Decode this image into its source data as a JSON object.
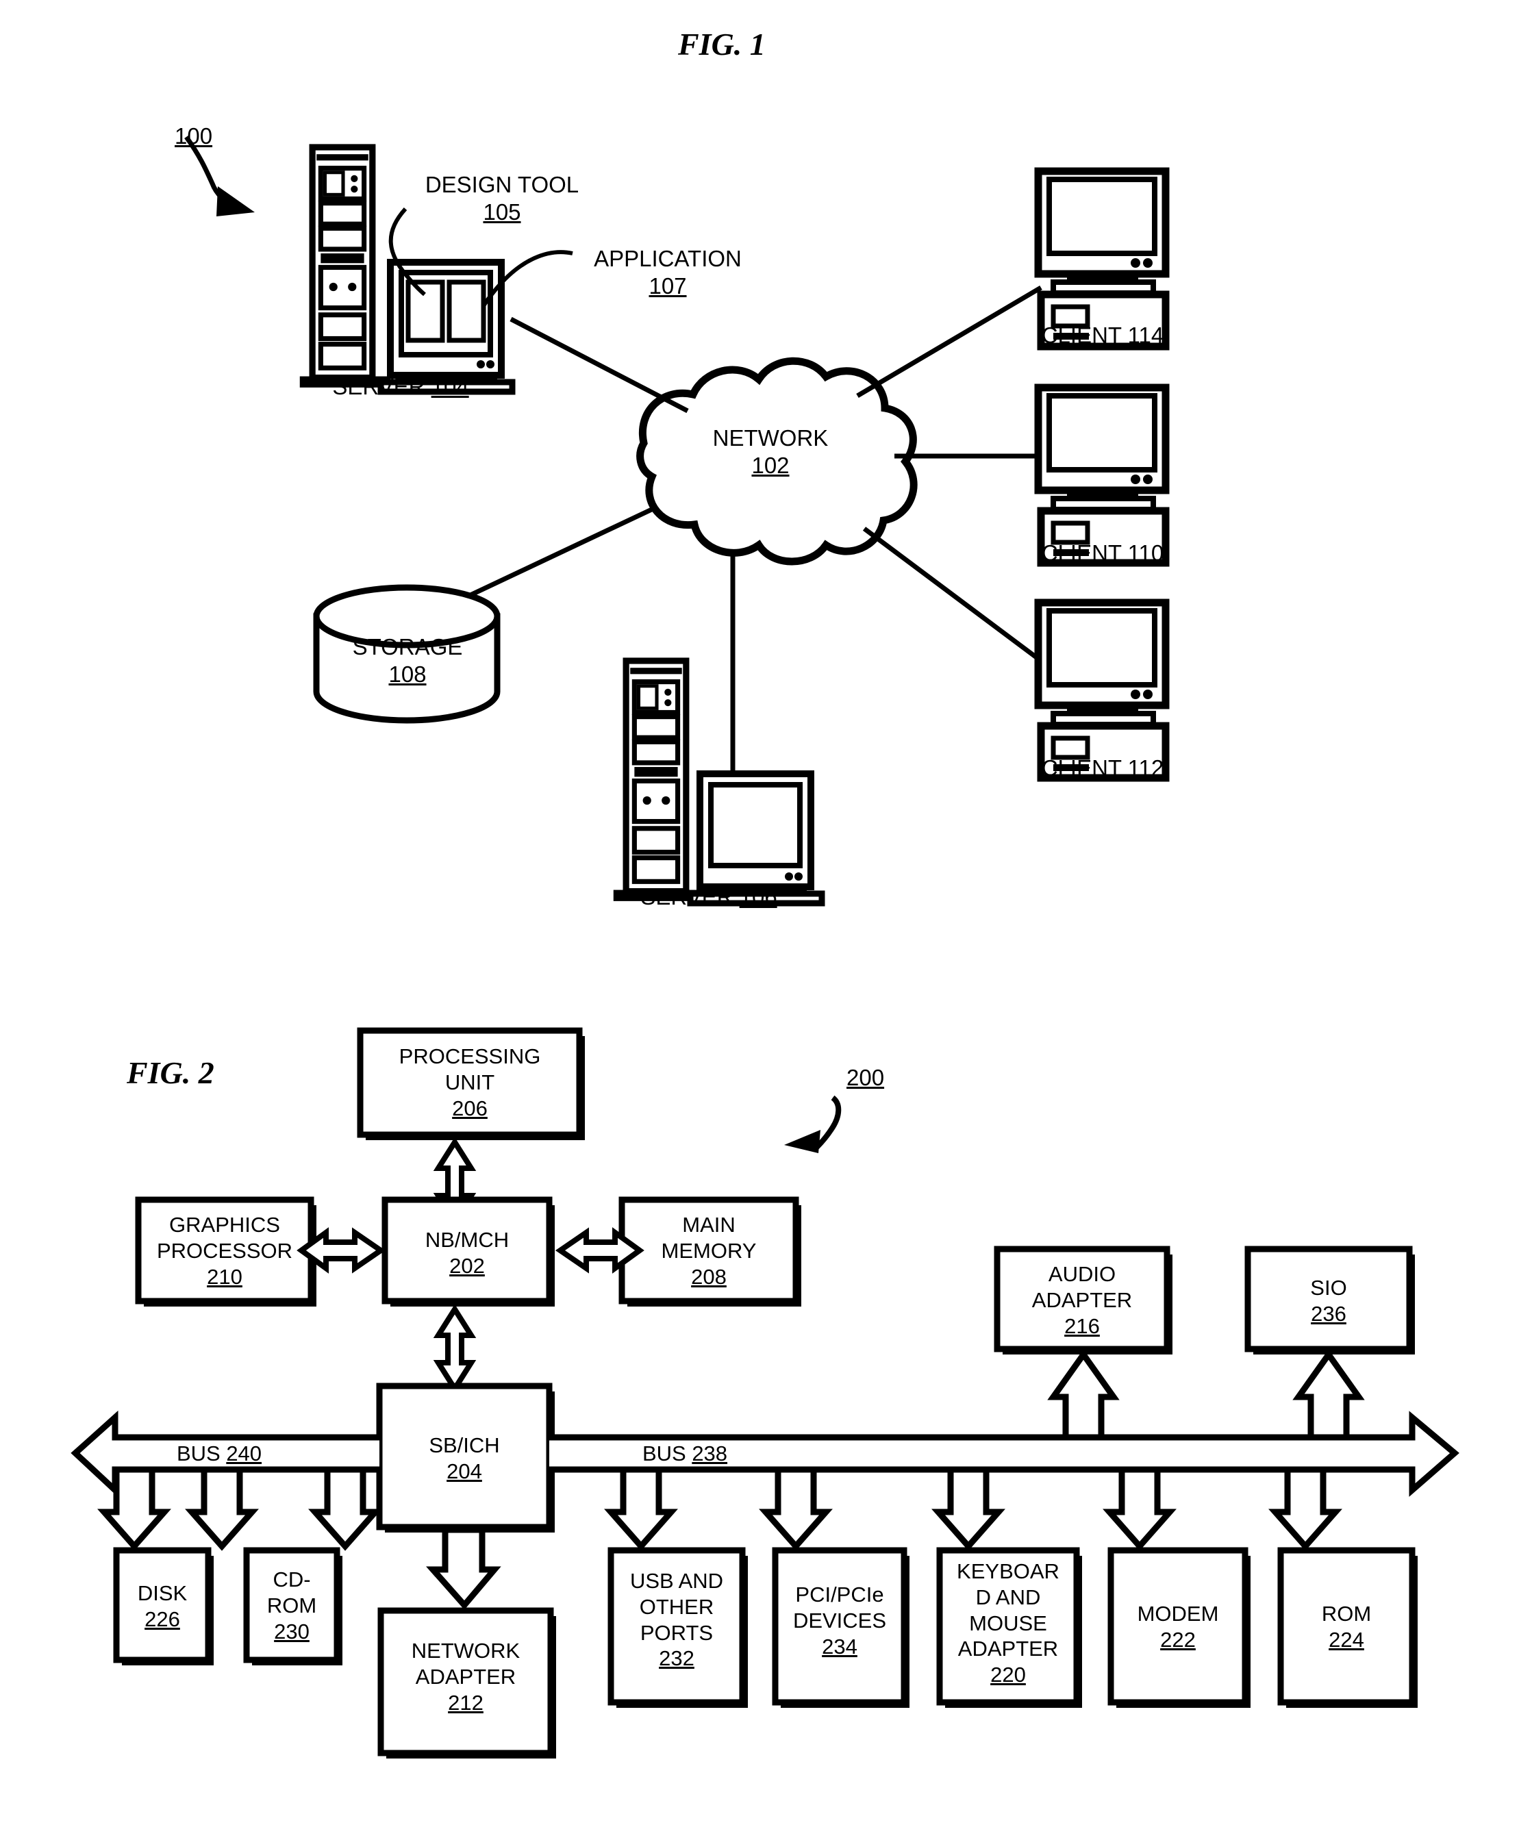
{
  "figures": [
    {
      "id": "fig1",
      "title": "FIG. 1",
      "ref": "100",
      "caption_nodes": [
        {
          "name": "server-104",
          "label": "SERVER ",
          "number": "104"
        },
        {
          "name": "design-tool-105",
          "label": "DESIGN TOOL",
          "number": "105"
        },
        {
          "name": "application-107",
          "label": "APPLICATION",
          "number": "107"
        },
        {
          "name": "network-102",
          "label": "NETWORK",
          "number": "102"
        },
        {
          "name": "storage-108",
          "label": "STORAGE",
          "number": "108"
        },
        {
          "name": "server-106",
          "label": "SERVER ",
          "number": "106"
        },
        {
          "name": "client-114",
          "label": "CLIENT ",
          "number": "114"
        },
        {
          "name": "client-110",
          "label": "CLIENT ",
          "number": "110"
        },
        {
          "name": "client-112",
          "label": "CLIENT ",
          "number": "112"
        }
      ]
    },
    {
      "id": "fig2",
      "title": "FIG. 2",
      "ref": "200",
      "boxes": [
        {
          "name": "processing-unit",
          "lines": [
            "PROCESSING",
            "UNIT"
          ],
          "number": "206"
        },
        {
          "name": "graphics-processor",
          "lines": [
            "GRAPHICS",
            "PROCESSOR"
          ],
          "number": "210"
        },
        {
          "name": "nb-mch",
          "lines": [
            "NB/MCH"
          ],
          "number": "202"
        },
        {
          "name": "main-memory",
          "lines": [
            "MAIN",
            "MEMORY"
          ],
          "number": "208"
        },
        {
          "name": "audio-adapter",
          "lines": [
            "AUDIO",
            "ADAPTER"
          ],
          "number": "216"
        },
        {
          "name": "sio",
          "lines": [
            "SIO"
          ],
          "number": "236"
        },
        {
          "name": "sb-ich",
          "lines": [
            "SB/ICH"
          ],
          "number": "204"
        },
        {
          "name": "disk",
          "lines": [
            "DISK"
          ],
          "number": "226"
        },
        {
          "name": "cd-rom",
          "lines": [
            "CD-",
            "ROM"
          ],
          "number": "230"
        },
        {
          "name": "network-adapter",
          "lines": [
            "NETWORK",
            "ADAPTER"
          ],
          "number": "212"
        },
        {
          "name": "usb-and-other-ports",
          "lines": [
            "USB AND",
            "OTHER",
            "PORTS"
          ],
          "number": "232"
        },
        {
          "name": "pci-pcie-devices",
          "lines": [
            "PCI/PCIe",
            "DEVICES"
          ],
          "number": "234"
        },
        {
          "name": "keyboard-and-mouse-adapter",
          "lines": [
            "KEYBOAR",
            "D AND",
            "MOUSE",
            "ADAPTER"
          ],
          "number": "220"
        },
        {
          "name": "modem",
          "lines": [
            "MODEM"
          ],
          "number": "222"
        },
        {
          "name": "rom",
          "lines": [
            "ROM"
          ],
          "number": "224"
        }
      ],
      "buses": [
        {
          "name": "bus-240",
          "label": "BUS ",
          "number": "240"
        },
        {
          "name": "bus-238",
          "label": "BUS ",
          "number": "238"
        }
      ]
    }
  ],
  "fig1": {
    "title": "FIG. 1",
    "ref": "100",
    "server104": {
      "label": "SERVER ",
      "number": "104"
    },
    "design_tool": {
      "label": "DESIGN TOOL",
      "number": "105"
    },
    "application": {
      "label": "APPLICATION",
      "number": "107"
    },
    "network": {
      "label": "NETWORK",
      "number": "102"
    },
    "storage": {
      "label": "STORAGE",
      "number": "108"
    },
    "server106": {
      "label": "SERVER ",
      "number": "106"
    },
    "client114": {
      "label": "CLIENT ",
      "number": "114"
    },
    "client110": {
      "label": "CLIENT ",
      "number": "110"
    },
    "client112": {
      "label": "CLIENT ",
      "number": "112"
    }
  },
  "fig2": {
    "title": "FIG. 2",
    "ref": "200",
    "processing_unit": {
      "l1": "PROCESSING",
      "l2": "UNIT",
      "num": "206"
    },
    "graphics_processor": {
      "l1": "GRAPHICS",
      "l2": "PROCESSOR",
      "num": "210"
    },
    "nb_mch": {
      "l1": "NB/MCH",
      "num": "202"
    },
    "main_memory": {
      "l1": "MAIN",
      "l2": "MEMORY",
      "num": "208"
    },
    "audio_adapter": {
      "l1": "AUDIO",
      "l2": "ADAPTER",
      "num": "216"
    },
    "sio": {
      "l1": "SIO",
      "num": "236"
    },
    "sb_ich": {
      "l1": "SB/ICH",
      "num": "204"
    },
    "disk": {
      "l1": "DISK",
      "num": "226"
    },
    "cd_rom": {
      "l1": "CD-",
      "l2": "ROM",
      "num": "230"
    },
    "network_adapter": {
      "l1": "NETWORK",
      "l2": "ADAPTER",
      "num": "212"
    },
    "usb_ports": {
      "l1": "USB AND",
      "l2": "OTHER",
      "l3": "PORTS",
      "num": "232"
    },
    "pci_devices": {
      "l1": "PCI/PCIe",
      "l2": "DEVICES",
      "num": "234"
    },
    "kbd_mouse": {
      "l1": "KEYBOAR",
      "l2": "D AND",
      "l3": "MOUSE",
      "l4": "ADAPTER",
      "num": "220"
    },
    "modem": {
      "l1": "MODEM",
      "num": "222"
    },
    "rom": {
      "l1": "ROM",
      "num": "224"
    },
    "bus240": {
      "label": "BUS ",
      "num": "240"
    },
    "bus238": {
      "label": "BUS ",
      "num": "238"
    }
  }
}
